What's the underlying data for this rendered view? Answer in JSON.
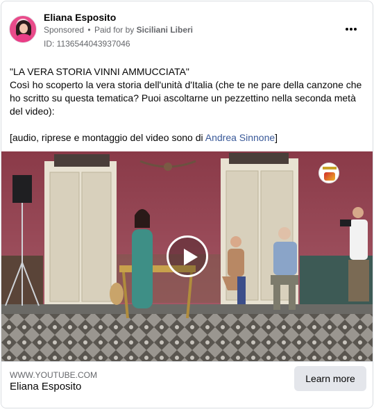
{
  "post": {
    "author_name": "Eliana Esposito",
    "sponsored_label": "Sponsored",
    "separator": "•",
    "paid_for_prefix": "Paid for by",
    "payer_name": "Siciliani Liberi",
    "id_label": "ID: 1136544043937046",
    "more_icon": "more-horizontal-icon"
  },
  "body": {
    "line1": "\"LA VERA STORIA VINNI AMMUCCIATA\"",
    "line2": "Così ho scoperto la vera storia dell'unità d'Italia (che te ne pare della canzone che ho scritto su questa tematica? Puoi ascoltarne un pezzettino nella seconda metà del video):",
    "credit_prefix": "[audio, riprese e montaggio del video sono di ",
    "credit_link": "Andrea Sinnone",
    "credit_suffix": "]"
  },
  "video": {
    "play_icon": "play-icon"
  },
  "link_preview": {
    "domain": "WWW.YOUTUBE.COM",
    "title": "Eliana Esposito",
    "cta_label": "Learn more"
  },
  "colors": {
    "link": "#385898",
    "muted_text": "#65676b",
    "button_bg": "#e4e6eb"
  }
}
